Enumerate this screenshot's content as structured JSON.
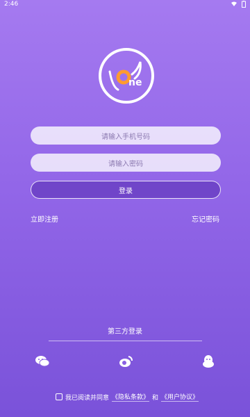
{
  "status": {
    "time": "2:46"
  },
  "form": {
    "phone_placeholder": "请输入手机号码",
    "password_placeholder": "请输入密码",
    "login_label": "登录"
  },
  "links": {
    "register": "立即注册",
    "forgot": "忘记密码"
  },
  "third_party": {
    "title": "第三方登录",
    "icons": [
      "wechat-icon",
      "weibo-icon",
      "qq-icon"
    ]
  },
  "agreement": {
    "prefix": "我已阅读并同意",
    "privacy": "《隐私条款》",
    "and": "和",
    "user": "《用户协议》"
  }
}
